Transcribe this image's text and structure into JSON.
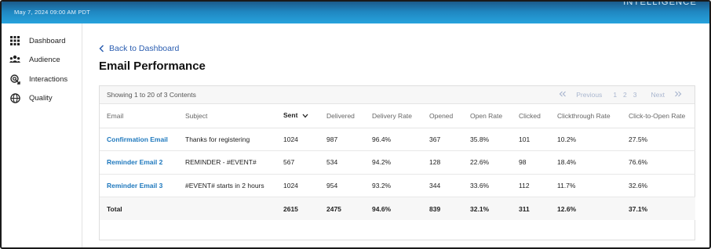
{
  "header": {
    "datetime": "May 7, 2024 09:00 AM PDT",
    "brand": "INTELLIGENCE"
  },
  "sidebar": {
    "items": [
      {
        "label": "Dashboard",
        "icon": "grid-icon"
      },
      {
        "label": "Audience",
        "icon": "people-icon"
      },
      {
        "label": "Interactions",
        "icon": "interactions-icon"
      },
      {
        "label": "Quality",
        "icon": "globe-icon"
      }
    ]
  },
  "main": {
    "back_label": "Back to Dashboard",
    "title": "Email Performance",
    "showing": "Showing 1 to 20 of 3 Contents",
    "pager": {
      "previous": "Previous",
      "pages": [
        "1",
        "2",
        "3"
      ],
      "next": "Next"
    }
  },
  "table": {
    "columns": [
      "Email",
      "Subject",
      "Sent",
      "Delivered",
      "Delivery Rate",
      "Opened",
      "Open Rate",
      "Clicked",
      "Clickthrough Rate",
      "Click-to-Open Rate"
    ],
    "sorted_column": "Sent",
    "rows": [
      [
        "Confirmation Email",
        "Thanks for registering",
        "1024",
        "987",
        "96.4%",
        "367",
        "35.8%",
        "101",
        "10.2%",
        "27.5%"
      ],
      [
        "Reminder Email 2",
        "REMINDER - #EVENT#",
        "567",
        "534",
        "94.2%",
        "128",
        "22.6%",
        "98",
        "18.4%",
        "76.6%"
      ],
      [
        "Reminder Email 3",
        "#EVENT# starts in 2 hours",
        "1024",
        "954",
        "93.2%",
        "344",
        "33.6%",
        "112",
        "11.7%",
        "32.6%"
      ]
    ],
    "total": [
      "Total",
      "",
      "2615",
      "2475",
      "94.6%",
      "839",
      "32.1%",
      "311",
      "12.6%",
      "37.1%"
    ]
  },
  "colors": {
    "accent": "#1e78bd",
    "link": "#2a5db0",
    "header_start": "#1b5a8a",
    "header_end": "#27a3dd"
  }
}
